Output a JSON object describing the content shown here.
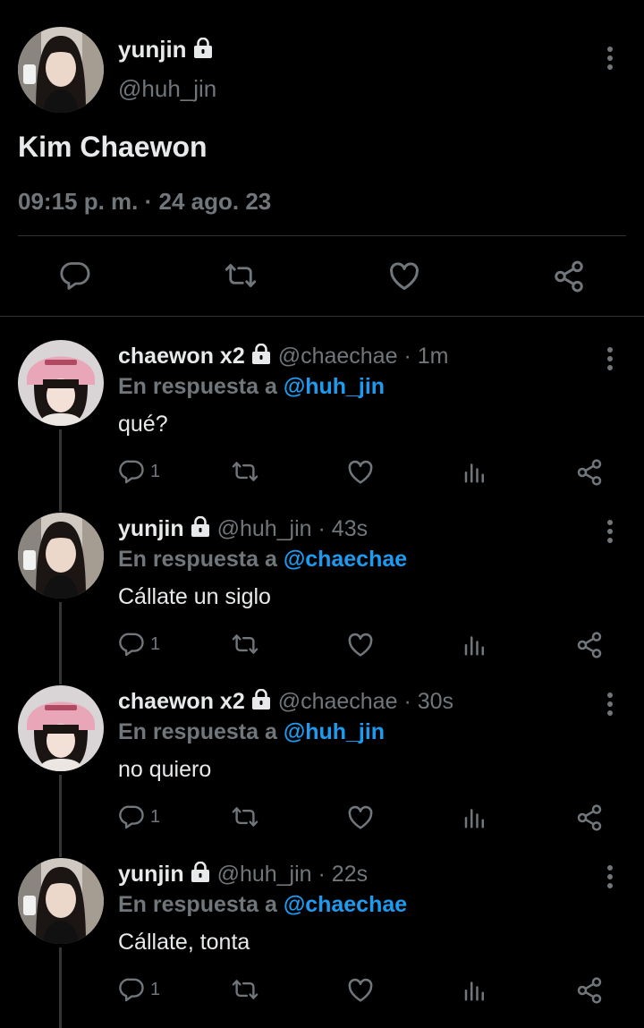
{
  "main_tweet": {
    "name": "yunjin",
    "handle": "@huh_jin",
    "text": "Kim Chaewon",
    "timestamp": "09:15 p. m. · 24 ago. 23"
  },
  "main_actions": [
    "reply-icon",
    "retweet-icon",
    "like-icon",
    "share-icon"
  ],
  "reply_prefix": "En respuesta a",
  "replies": [
    {
      "name": "chaewon x2",
      "handle": "@chaechae",
      "time": "· 1m",
      "reply_to": "@huh_jin",
      "text": "qué?",
      "reply_count": "1",
      "avatar": "pink-beanie"
    },
    {
      "name": "yunjin",
      "handle": "@huh_jin",
      "time": "· 43s",
      "reply_to": "@chaechae",
      "text": "Cállate un siglo",
      "reply_count": "1",
      "avatar": "dark-hair"
    },
    {
      "name": "chaewon x2",
      "handle": "@chaechae",
      "time": "· 30s",
      "reply_to": "@huh_jin",
      "text": "no quiero",
      "reply_count": "1",
      "avatar": "pink-beanie"
    },
    {
      "name": "yunjin",
      "handle": "@huh_jin",
      "time": "· 22s",
      "reply_to": "@chaechae",
      "text": "Cállate, tonta",
      "reply_count": "1",
      "avatar": "dark-hair"
    }
  ],
  "colors": {
    "background": "#000000",
    "text": "#e7e9ea",
    "secondary": "#71767b",
    "link": "#1d9bf0",
    "divider": "#2f3336"
  }
}
